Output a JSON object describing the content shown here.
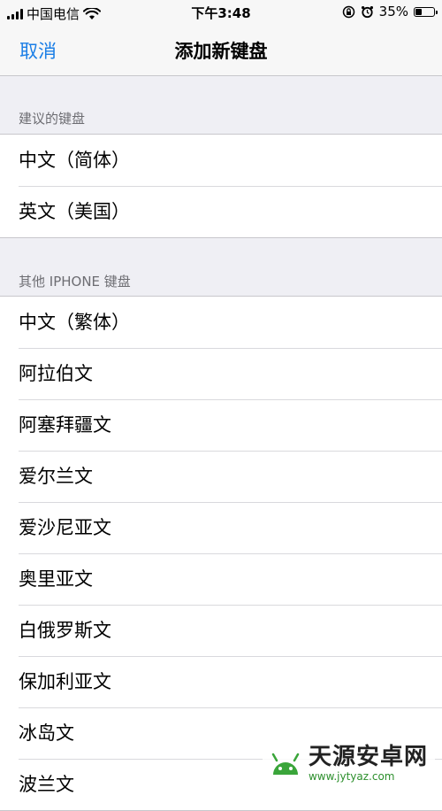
{
  "status_bar": {
    "carrier": "中国电信",
    "time": "下午3:48",
    "battery_percent_label": "35%",
    "battery_level": 0.35
  },
  "nav": {
    "cancel_label": "取消",
    "title": "添加新键盘"
  },
  "sections": [
    {
      "header": "建议的键盘",
      "items": [
        "中文（简体）",
        "英文（美国）"
      ]
    },
    {
      "header": "其他 IPHONE 键盘",
      "items": [
        "中文（繁体）",
        "阿拉伯文",
        "阿塞拜疆文",
        "爱尔兰文",
        "爱沙尼亚文",
        "奥里亚文",
        "白俄罗斯文",
        "保加利亚文",
        "冰岛文",
        "波兰文"
      ]
    }
  ],
  "watermark": {
    "title": "天源安卓网",
    "url": "www.jytyaz.com"
  },
  "colors": {
    "accent": "#1a7ee6",
    "background": "#efeff4"
  }
}
